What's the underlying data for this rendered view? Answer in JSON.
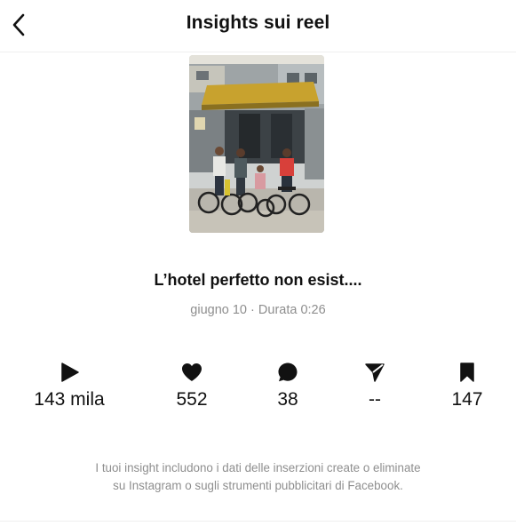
{
  "header": {
    "title": "Insights sui reel",
    "back_icon": "chevron-left-icon"
  },
  "reel": {
    "caption": "L’hotel perfetto non esist....",
    "date": "giugno 10",
    "separator": "·",
    "duration": "Durata 0:26"
  },
  "stats": [
    {
      "icon": "play-icon",
      "value": "143 mila"
    },
    {
      "icon": "heart-icon",
      "value": "552"
    },
    {
      "icon": "comment-icon",
      "value": "38"
    },
    {
      "icon": "share-icon",
      "value": "--"
    },
    {
      "icon": "bookmark-icon",
      "value": "147"
    }
  ],
  "note": {
    "line1": "I tuoi insight includono i dati delle inserzioni create o eliminate",
    "line2": "su Instagram o sugli strumenti pubblicitari di Facebook."
  }
}
